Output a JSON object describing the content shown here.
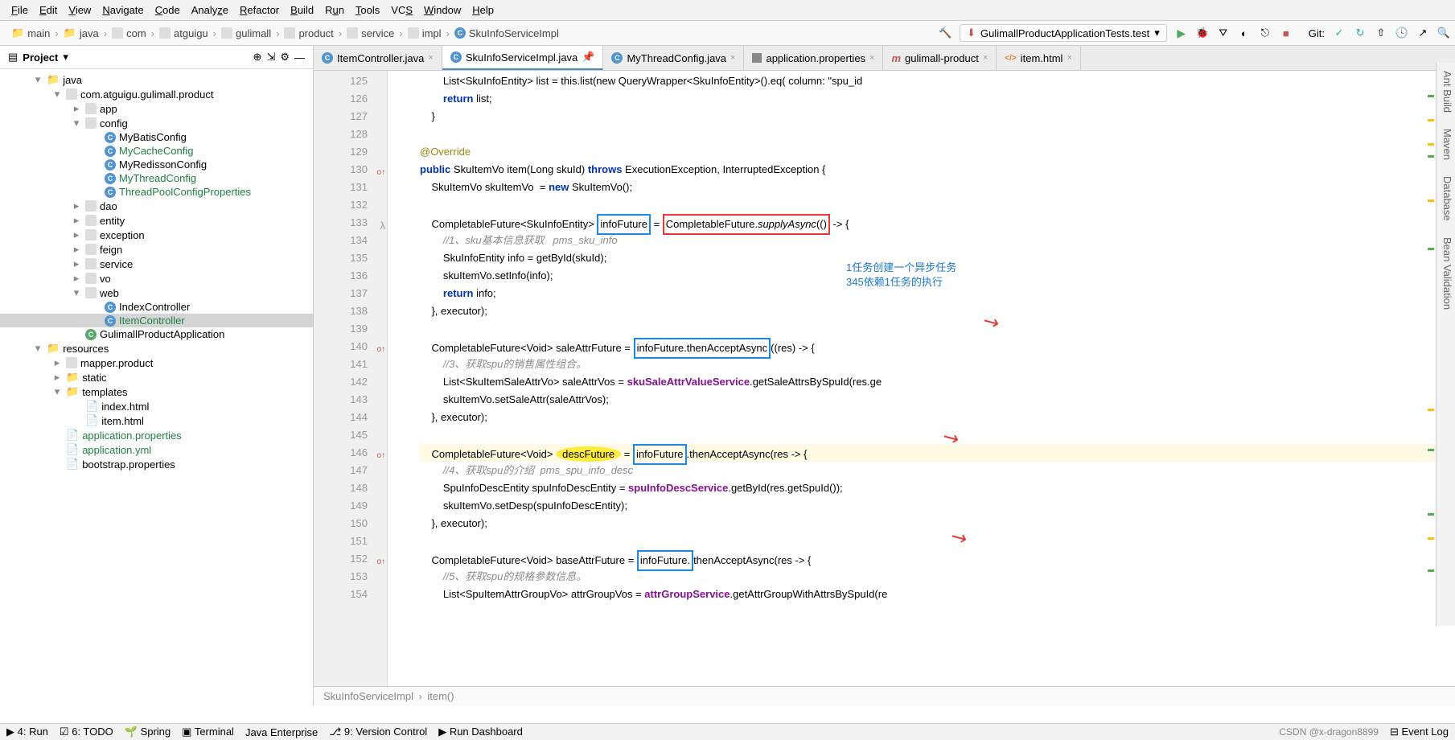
{
  "menu": {
    "file": "File",
    "edit": "Edit",
    "view": "View",
    "navigate": "Navigate",
    "code": "Code",
    "analyze": "Analyze",
    "refactor": "Refactor",
    "build": "Build",
    "run": "Run",
    "tools": "Tools",
    "vcs": "VCS",
    "window": "Window",
    "help": "Help"
  },
  "breadcrumbs": [
    "main",
    "java",
    "com",
    "atguigu",
    "gulimall",
    "product",
    "service",
    "impl",
    "SkuInfoServiceImpl"
  ],
  "runConfig": "GulimallProductApplicationTests.test",
  "gitLabel": "Git:",
  "projectPanel": {
    "title": "Project"
  },
  "tree": {
    "java": "java",
    "pkg": "com.atguigu.gulimall.product",
    "app": "app",
    "config": "config",
    "mybatis": "MyBatisConfig",
    "mycache": "MyCacheConfig",
    "myredisson": "MyRedissonConfig",
    "mythread": "MyThreadConfig",
    "threadpool": "ThreadPoolConfigProperties",
    "dao": "dao",
    "entity": "entity",
    "exception": "exception",
    "feign": "feign",
    "service": "service",
    "vo": "vo",
    "web": "web",
    "indexctrl": "IndexController",
    "itemctrl": "ItemController",
    "appclass": "GulimallProductApplication",
    "resources": "resources",
    "mapper": "mapper.product",
    "static": "static",
    "templates": "templates",
    "indexhtml": "index.html",
    "itemhtml": "item.html",
    "appprops": "application.properties",
    "appyml": "application.yml",
    "bootstrap": "bootstrap.properties"
  },
  "tabs": [
    {
      "name": "ItemController.java",
      "icon": "c"
    },
    {
      "name": "SkuInfoServiceImpl.java",
      "icon": "c",
      "active": true
    },
    {
      "name": "MyThreadConfig.java",
      "icon": "c"
    },
    {
      "name": "application.properties",
      "icon": "p"
    },
    {
      "name": "gulimall-product",
      "icon": "m"
    },
    {
      "name": "item.html",
      "icon": "h"
    }
  ],
  "gutter": [
    "125",
    "126",
    "127",
    "128",
    "129",
    "130",
    "131",
    "132",
    "133",
    "134",
    "135",
    "136",
    "137",
    "138",
    "139",
    "140",
    "141",
    "142",
    "143",
    "144",
    "145",
    "146",
    "147",
    "148",
    "149",
    "150",
    "151",
    "152",
    "153",
    "154"
  ],
  "code": {
    "l125": "        List<SkuInfoEntity> list = this.list(new QueryWrapper<SkuInfoEntity>().eq( column: \"spu_id",
    "l126_a": "        ",
    "l126_kw": "return",
    "l126_b": " list;",
    "l127": "    }",
    "l129": "@Override",
    "l130_a": "",
    "l130_pub": "public",
    "l130_b": " SkuItemVo item(Long skuId) ",
    "l130_th": "throws",
    "l130_c": " ExecutionException, InterruptedException {",
    "l131_a": "    SkuItemVo skuItemVo  = ",
    "l131_new": "new",
    "l131_b": " SkuItemVo();",
    "l133_a": "    CompletableFuture<SkuInfoEntity> ",
    "l133_box1": "infoFuture",
    "l133_b": " = ",
    "l133_box2": "CompletableFuture.",
    "l133_box2i": "supplyAsync",
    "l133_box2b": "(()",
    "l133_c": " -> {",
    "l134": "        //1、sku基本信息获取   pms_sku_info",
    "l135": "        SkuInfoEntity info = getById(skuId);",
    "l136": "        skuItemVo.setInfo(info);",
    "l137_a": "        ",
    "l137_kw": "return",
    "l137_b": " info;",
    "l138": "    }, executor);",
    "l140_a": "    CompletableFuture<Void> saleAttrFuture = ",
    "l140_box": "infoFuture.thenAcceptAsync",
    "l140_b": "((res) -> {",
    "l141": "        //3、获取spu的销售属性组合。",
    "l142_a": "        List<SkuItemSaleAttrVo> saleAttrVos = ",
    "l142_svc": "skuSaleAttrValueService",
    "l142_b": ".getSaleAttrsBySpuId(res.ge",
    "l143": "        skuItemVo.setSaleAttr(saleAttrVos);",
    "l144": "    }, executor);",
    "l146_a": "    CompletableFuture<Void> ",
    "l146_hl": "descFuture",
    "l146_b": " = ",
    "l146_box": "infoFuture",
    "l146_c": ".thenAcceptAsync(res -> {",
    "l147": "        //4、获取spu的介绍  pms_spu_info_desc",
    "l148_a": "        SpuInfoDescEntity spuInfoDescEntity = ",
    "l148_svc": "spuInfoDescService",
    "l148_b": ".getById(res.getSpuId());",
    "l149": "        skuItemVo.setDesp(spuInfoDescEntity);",
    "l150": "    }, executor);",
    "l152_a": "    CompletableFuture<Void> baseAttrFuture = ",
    "l152_box": "infoFuture.",
    "l152_b": "thenAcceptAsync(res -> {",
    "l153": "        //5、获取spu的规格参数信息。",
    "l154_a": "        List<SpuItemAttrGroupVo> attrGroupVos = ",
    "l154_svc": "attrGroupService",
    "l154_b": ".getAttrGroupWithAttrsBySpuId(re"
  },
  "note1": "1任务创建一个异步任务",
  "note2": "345依赖1任务的执行",
  "bottomCrumb": {
    "a": "SkuInfoServiceImpl",
    "b": "item()"
  },
  "status": {
    "run": "4: Run",
    "todo": "6: TODO",
    "spring": "Spring",
    "terminal": "Terminal",
    "java": "Java Enterprise",
    "vc": "9: Version Control",
    "dash": "Run Dashboard",
    "eventlog": "Event Log",
    "watermark": "CSDN @x-dragon8899"
  },
  "rightTools": [
    "Ant Build",
    "Maven",
    "Database",
    "Bean Validation"
  ]
}
